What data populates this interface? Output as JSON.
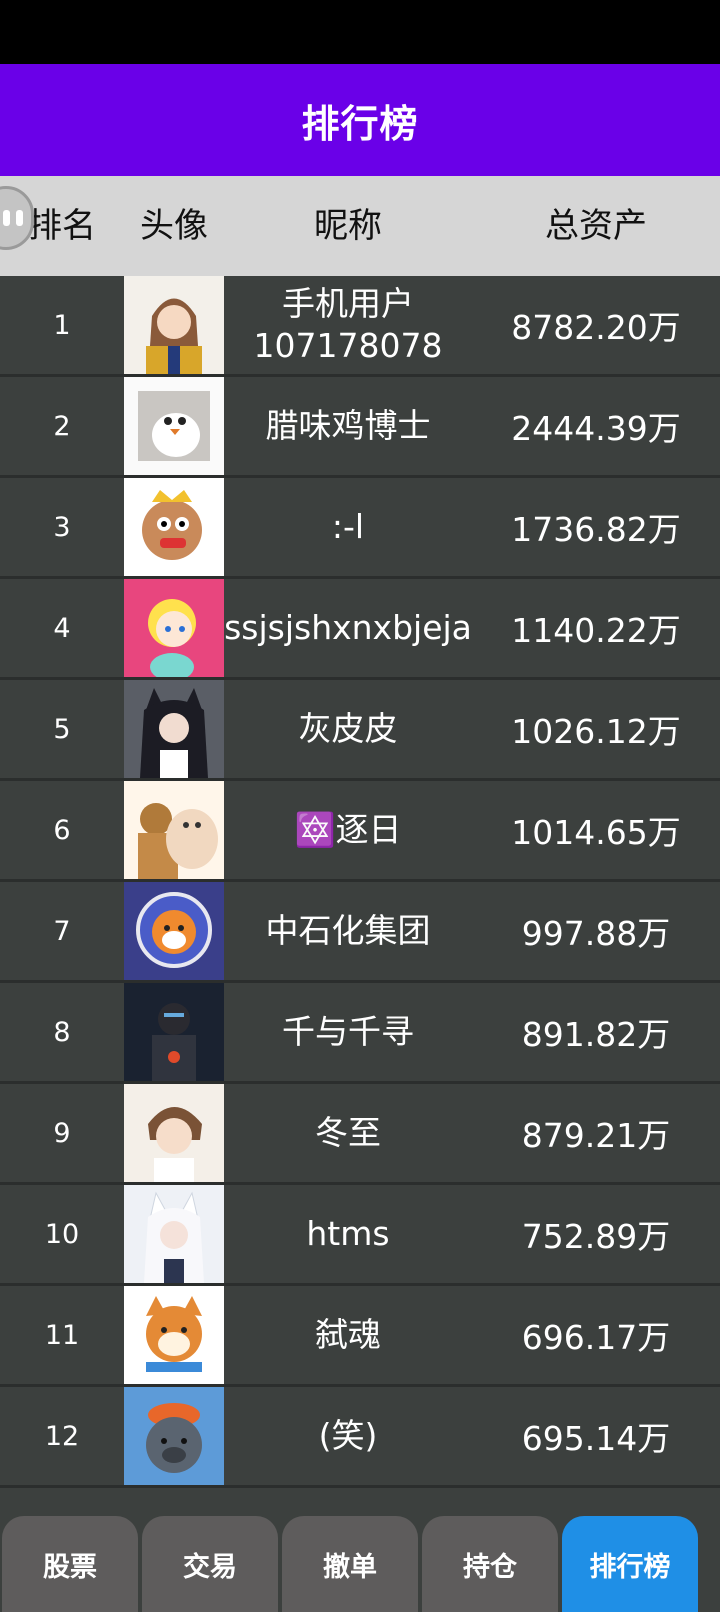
{
  "title": "排行榜",
  "columns": {
    "rank": "排名",
    "avatar": "头像",
    "nickname": "昵称",
    "assets": "总资产"
  },
  "rows": [
    {
      "rank": "1",
      "nickname": "手机用户\n107178078",
      "assets": "8782.20万",
      "avatar_icon": "anime-girl-avatar"
    },
    {
      "rank": "2",
      "nickname": "腊味鸡博士",
      "assets": "2444.39万",
      "avatar_icon": "white-bird-avatar"
    },
    {
      "rank": "3",
      "nickname": ":-l",
      "assets": "1736.82万",
      "avatar_icon": "cartoon-face-avatar"
    },
    {
      "rank": "4",
      "nickname": "ssjsjshxnxbjeja",
      "assets": "1140.22万",
      "avatar_icon": "pink-cartoon-avatar"
    },
    {
      "rank": "5",
      "nickname": "灰皮皮",
      "assets": "1026.12万",
      "avatar_icon": "anime-wolf-girl-avatar"
    },
    {
      "rank": "6",
      "nickname": "🔯逐日",
      "assets": "1014.65万",
      "avatar_icon": "pig-and-man-avatar"
    },
    {
      "rank": "7",
      "nickname": "中石化集团",
      "assets": "997.88万",
      "avatar_icon": "shiba-astronaut-avatar"
    },
    {
      "rank": "8",
      "nickname": "千与千寻",
      "assets": "891.82万",
      "avatar_icon": "dark-warrior-avatar"
    },
    {
      "rank": "9",
      "nickname": "冬至",
      "assets": "879.21万",
      "avatar_icon": "anime-boy-avatar"
    },
    {
      "rank": "10",
      "nickname": "htms",
      "assets": "752.89万",
      "avatar_icon": "white-fox-girl-avatar"
    },
    {
      "rank": "11",
      "nickname": "弑魂",
      "assets": "696.17万",
      "avatar_icon": "shiba-dog-avatar"
    },
    {
      "rank": "12",
      "nickname": "(笑)",
      "assets": "695.14万",
      "avatar_icon": "grey-bear-avatar"
    }
  ],
  "nav": [
    {
      "label": "股票",
      "active": false
    },
    {
      "label": "交易",
      "active": false
    },
    {
      "label": "撤单",
      "active": false
    },
    {
      "label": "持仓",
      "active": false
    },
    {
      "label": "排行榜",
      "active": true
    }
  ],
  "colors": {
    "title_bar": "#6a00e8",
    "header_bg": "#d6d6d6",
    "row_bg": "#3c403e",
    "nav_btn": "#5e5c5c",
    "nav_active": "#1f8fe6"
  }
}
